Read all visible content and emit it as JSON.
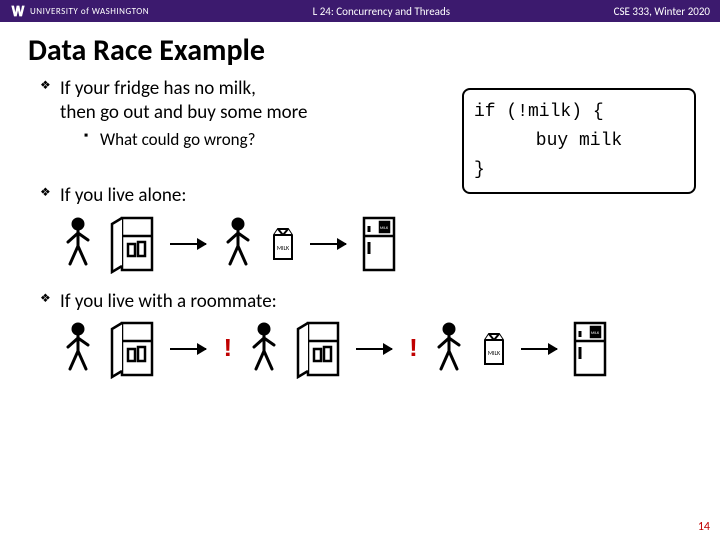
{
  "topbar": {
    "university": "UNIVERSITY of WASHINGTON",
    "center": "L 24: Concurrency and Threads",
    "right": "CSE 333, Winter 2020"
  },
  "title": "Data Race Example",
  "bullets": {
    "b1_line1": "If your fridge has no milk,",
    "b1_line2": "then go out and buy some more",
    "b1_sub": "What could go wrong?",
    "b2": "If you live alone:",
    "b3": "If you live with a roommate:"
  },
  "code": {
    "line1": "if (!milk) {",
    "line2": "buy milk",
    "line3": "}"
  },
  "exclaim": "!",
  "page": "14",
  "icons": {
    "walker": "person-walking-icon",
    "milk": "milk-carton-icon",
    "fridge_open": "fridge-open-icon",
    "fridge_closed": "fridge-closed-icon"
  }
}
